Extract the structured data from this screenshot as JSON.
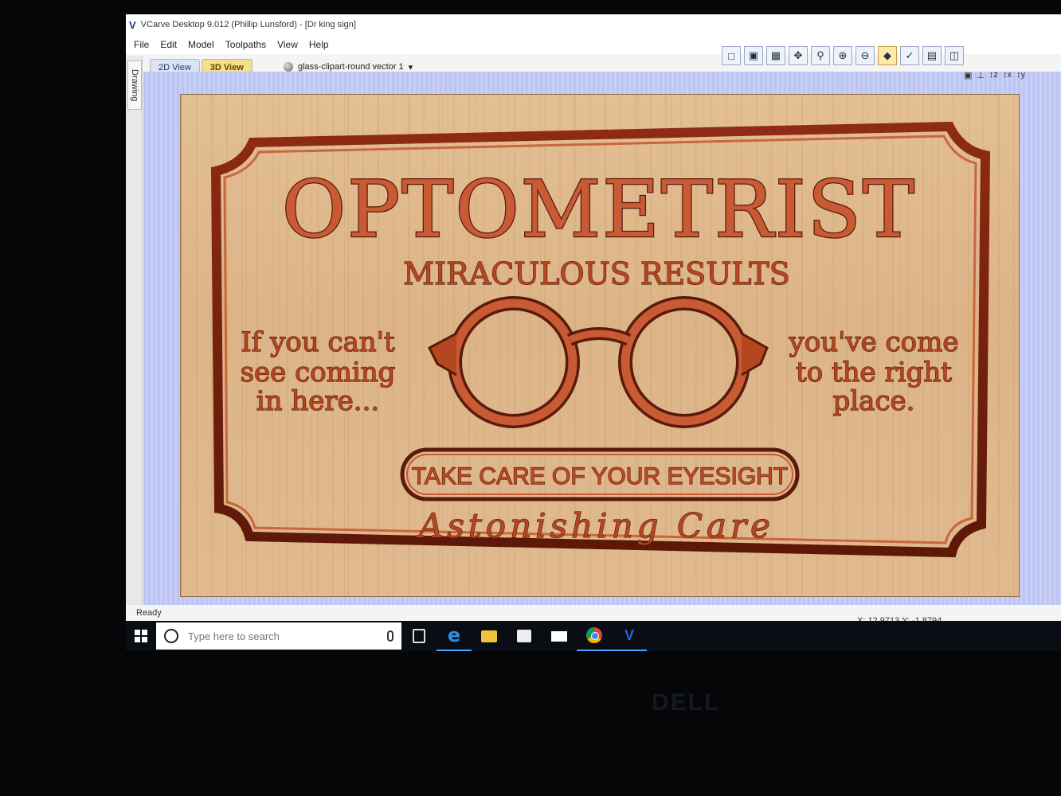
{
  "app": {
    "title": "VCarve Desktop 9.012 (Phillip Lunsford) - [Dr king sign]"
  },
  "menu": [
    "File",
    "Edit",
    "Model",
    "Toolpaths",
    "View",
    "Help"
  ],
  "left_panel": {
    "tab_label": "Drawing"
  },
  "view_tabs": {
    "tab_2d": "2D View",
    "tab_3d": "3D View",
    "active": "3D View"
  },
  "layer": {
    "name": "glass-clipart-round vector 1"
  },
  "toolbar": {
    "icons": [
      "view-fit-icon",
      "view-select-icon",
      "grid-icon",
      "pan-icon",
      "zoom-icon",
      "zoom-in-icon",
      "zoom-out-icon",
      "render-icon",
      "sweep-icon",
      "layout-icon",
      "split-view-icon"
    ],
    "highlighted": "render-icon"
  },
  "axis_tools": [
    "iso-view-icon",
    "x-axis-icon",
    "z-axis-icon",
    "x-top-icon",
    "y-top-icon"
  ],
  "sign": {
    "title": "OPTOMETRIST",
    "subtitle": "MIRACULOUS RESULTS",
    "left_text": [
      "If you can't",
      "see coming",
      "in here..."
    ],
    "right_text": [
      "you've come",
      "to the right",
      "place."
    ],
    "banner": "TAKE CARE OF YOUR EYESIGHT",
    "tagline": "Astonishing Care",
    "colors": {
      "wood": "#dcb487",
      "carve": "#c85a34",
      "edge": "#5a1a0c"
    }
  },
  "status": {
    "text": "Ready",
    "coords": "X: 12.9713 Y: -1.8794"
  },
  "taskbar": {
    "search_placeholder": "Type here to search",
    "apps": [
      "task-view-icon",
      "edge-icon",
      "file-explorer-icon",
      "store-icon",
      "mail-icon",
      "chrome-icon",
      "vcarve-icon"
    ],
    "active_app": "vcarve-icon"
  }
}
